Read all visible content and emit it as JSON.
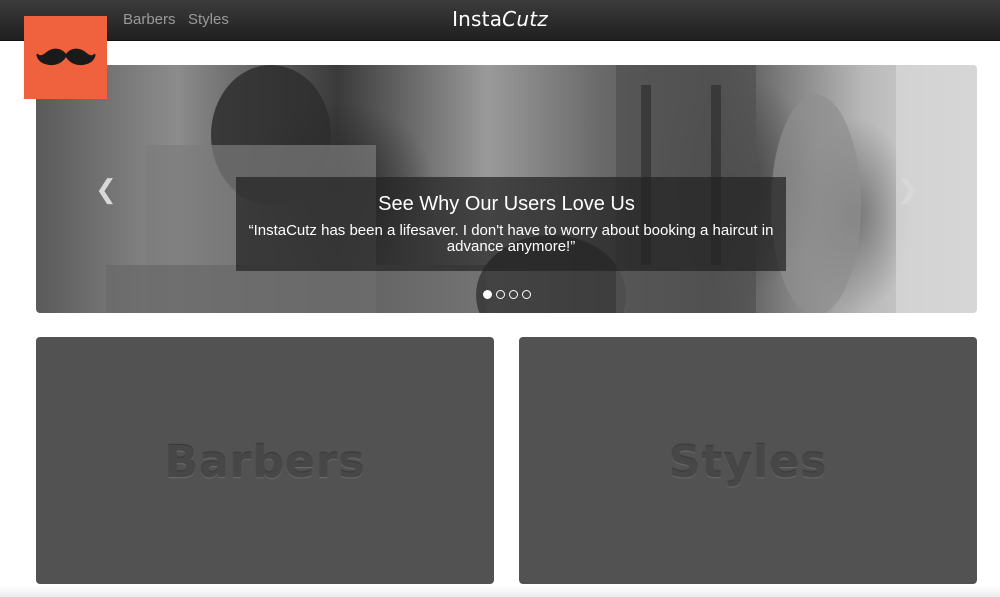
{
  "navbar": {
    "links": [
      {
        "label": "Barbers"
      },
      {
        "label": "Styles"
      }
    ],
    "brand": {
      "part1": "Insta",
      "part2": "Cutz"
    }
  },
  "logo": {
    "icon": "mustache-icon",
    "color": "#f0623e"
  },
  "carousel": {
    "title": "See Why Our Users Love Us",
    "quote": "“InstaCutz has been a lifesaver. I don't have to worry about booking a haircut in advance anymore!”",
    "prev_icon": "chevron-left-icon",
    "next_icon": "chevron-right-icon",
    "indicators": {
      "count": 4,
      "active": 0
    }
  },
  "tiles": [
    {
      "label": "Barbers"
    },
    {
      "label": "Styles"
    }
  ]
}
